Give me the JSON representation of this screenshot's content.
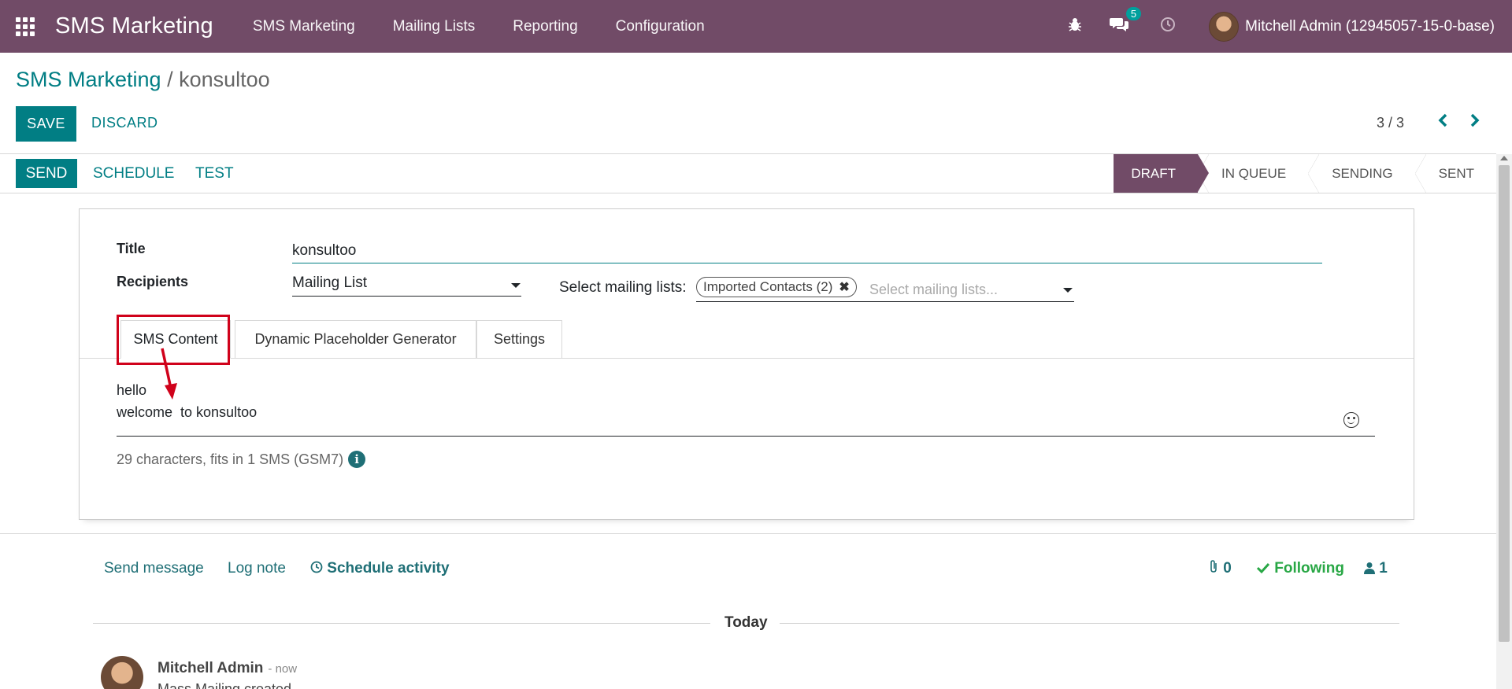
{
  "navbar": {
    "brand": "SMS Marketing",
    "menu": [
      "SMS Marketing",
      "Mailing Lists",
      "Reporting",
      "Configuration"
    ],
    "chat_badge": "5",
    "user": "Mitchell Admin (12945057-15-0-base)"
  },
  "breadcrumb": {
    "parent": "SMS Marketing",
    "separator": " / ",
    "current": "konsultoo"
  },
  "controls": {
    "save": "SAVE",
    "discard": "DISCARD",
    "pager": "3 / 3"
  },
  "statusbar": {
    "send": "SEND",
    "schedule": "SCHEDULE",
    "test": "TEST",
    "stages": [
      "DRAFT",
      "IN QUEUE",
      "SENDING",
      "SENT"
    ],
    "active_stage": "DRAFT"
  },
  "form": {
    "title_label": "Title",
    "title_value": "konsultoo",
    "recipients_label": "Recipients",
    "recipients_value": "Mailing List",
    "mailing_lists_label": "Select mailing lists:",
    "mailing_list_tag": "Imported Contacts (2)",
    "mailing_lists_placeholder": "Select mailing lists..."
  },
  "tabs": [
    "SMS Content",
    "Dynamic Placeholder Generator",
    "Settings"
  ],
  "sms": {
    "line1": "hello",
    "line2": "welcome  to konsultoo",
    "count": "29 characters, fits in 1 SMS (GSM7)"
  },
  "chatter": {
    "send_message": "Send message",
    "log_note": "Log note",
    "schedule_activity": "Schedule activity",
    "attachments": "0",
    "following": "Following",
    "followers": "1",
    "date_divider": "Today",
    "author": "Mitchell Admin",
    "time": "- now",
    "body": "Mass Mailing created"
  },
  "colors": {
    "brand": "#714b67",
    "accent": "#017e84",
    "highlight": "#d0021b"
  }
}
